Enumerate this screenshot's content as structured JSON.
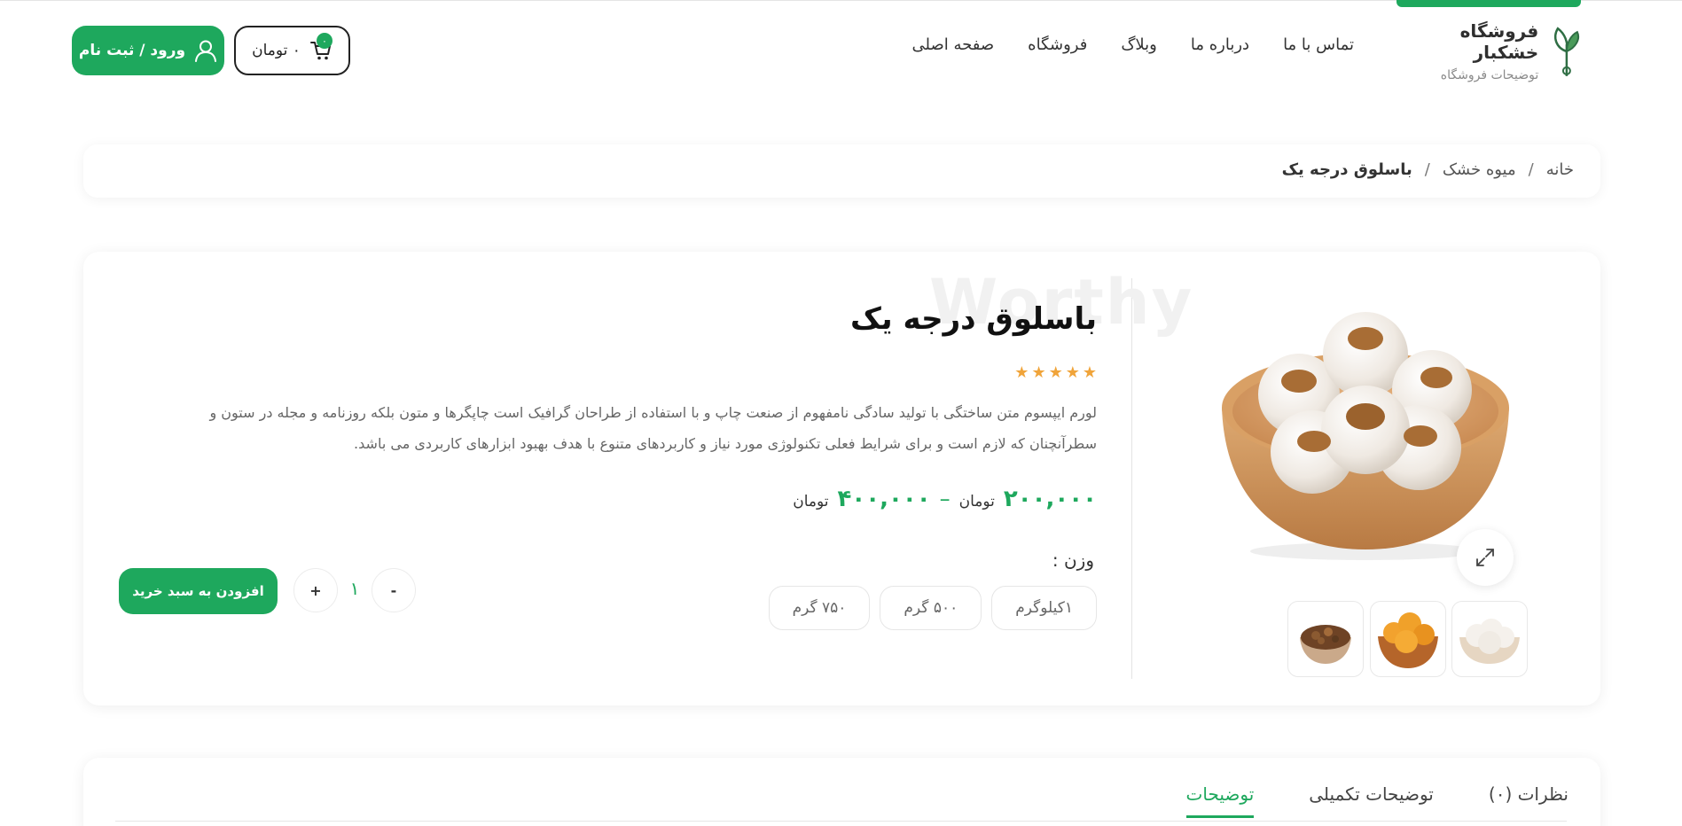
{
  "header": {
    "brand_name": "فروشگاه خشکبار",
    "brand_sub": "توضیحات فروشگاه",
    "nav": [
      "صفحه اصلی",
      "فروشگاه",
      "وبلاگ",
      "درباره ما",
      "تماس با ما"
    ],
    "cart_total": "۰ تومان",
    "cart_count": "۰",
    "login_label": "ورود / ثبت نام"
  },
  "breadcrumb": {
    "home": "خانه",
    "category": "میوه خشک",
    "current": "باسلوق درجه یک",
    "separator": "/"
  },
  "product": {
    "watermark": "Worthy",
    "title": "باسلوق درجه یک",
    "rating": 5,
    "description": "لورم ایپسوم متن ساختگی با تولید سادگی نامفهوم از صنعت چاپ و با استفاده از طراحان گرافیک است چاپگرها و متون بلکه روزنامه و مجله در ستون و سطرآنچنان که لازم است و برای شرایط فعلی تکنولوژی مورد نیاز و کاربردهای متنوع با هدف بهبود ابزارهای کاربردی می باشد.",
    "price_min": "۲۰۰,۰۰۰",
    "price_max": "۴۰۰,۰۰۰",
    "currency": "تومان",
    "dash": "–",
    "weight_label": "وزن :",
    "weights": [
      "۱کیلوگرم",
      "۵۰۰ گرم",
      "۷۵۰ گرم"
    ],
    "quantity": "۱",
    "minus_label": "-",
    "plus_label": "+",
    "add_to_cart": "افزودن به سبد خرید"
  },
  "tabs": [
    "توضیحات",
    "توضیحات تکمیلی",
    "نظرات (۰)"
  ],
  "colors": {
    "accent": "#1ea85d",
    "star": "#f0a43a"
  }
}
